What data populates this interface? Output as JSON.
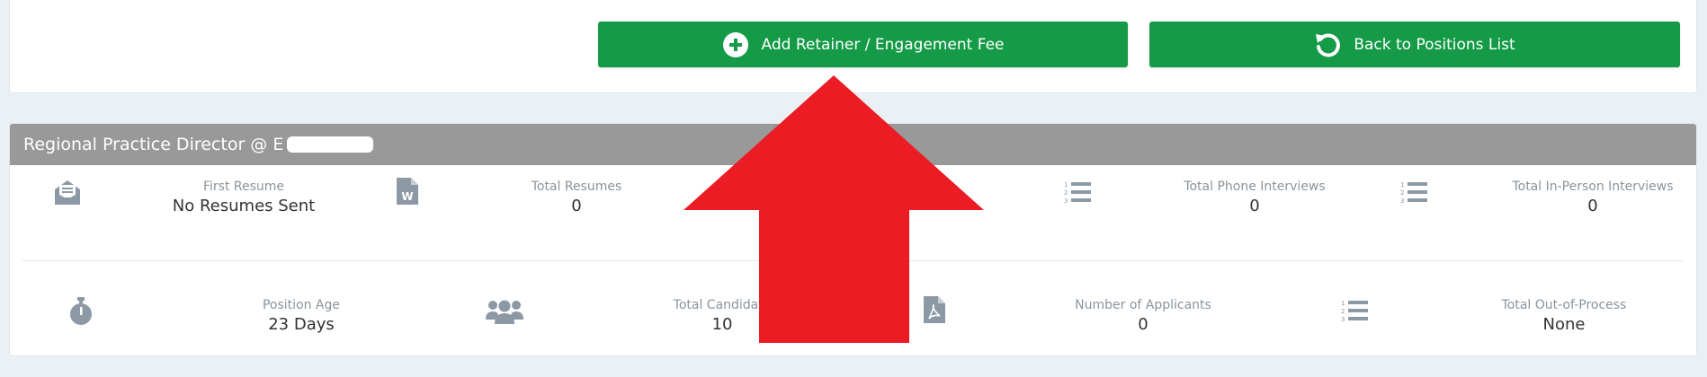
{
  "toolbar": {
    "add_label": "Add Retainer / Engagement Fee",
    "back_label": "Back to Positions List"
  },
  "position": {
    "title": "Regional Practice Director @ E"
  },
  "stats_row1": [
    {
      "label": "First Resume",
      "value": "No Resumes Sent",
      "icon": "envelope-open-icon"
    },
    {
      "label": "Total Resumes",
      "value": "0",
      "icon": "word-document-icon"
    },
    {
      "label": "",
      "value": "",
      "icon": ""
    },
    {
      "label": "Total Phone Interviews",
      "value": "0",
      "icon": "ordered-list-icon"
    },
    {
      "label": "Total In-Person Interviews",
      "value": "0",
      "icon": "ordered-list-icon"
    }
  ],
  "stats_row2": [
    {
      "label": "Position Age",
      "value": "23 Days",
      "icon": "stopwatch-icon"
    },
    {
      "label": "Total Candidate",
      "value": "10",
      "icon": "users-icon"
    },
    {
      "label": "Number of Applicants",
      "value": "0",
      "icon": "pdf-document-icon"
    },
    {
      "label": "Total Out-of-Process",
      "value": "None",
      "icon": "ordered-list-icon"
    }
  ],
  "colors": {
    "button_green": "#159a47",
    "header_gray": "#999999",
    "arrow_red": "#ec1c24",
    "icon_gray": "#8c99a5"
  }
}
